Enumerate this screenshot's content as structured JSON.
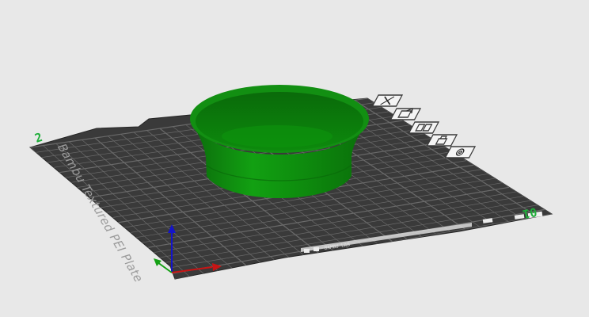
{
  "viewport": {
    "plate": {
      "label": "Bambu Textured PEI Plate",
      "number_left": "2",
      "number_right": "01",
      "bottom_strip_text": "BAMBU LAB"
    },
    "colors": {
      "background": "#e8e8e8",
      "plate": "#3a3a3a",
      "grid": "#6a6a6a",
      "model": "#0a8a0a",
      "plate_number": "#1fae3a",
      "axis_x": "#c81414",
      "axis_y": "#14a014",
      "axis_z": "#1414c8"
    },
    "toolbar": {
      "buttons": [
        {
          "name": "delete-plate-button",
          "icon": "close-icon"
        },
        {
          "name": "orient-plate-button",
          "icon": "orient-icon"
        },
        {
          "name": "arrange-plate-button",
          "icon": "arrange-icon"
        },
        {
          "name": "lock-plate-button",
          "icon": "lock-icon"
        },
        {
          "name": "plate-settings-button",
          "icon": "settings-icon"
        }
      ]
    },
    "model": {
      "name": "bowl",
      "color": "#0a8a0a"
    }
  }
}
